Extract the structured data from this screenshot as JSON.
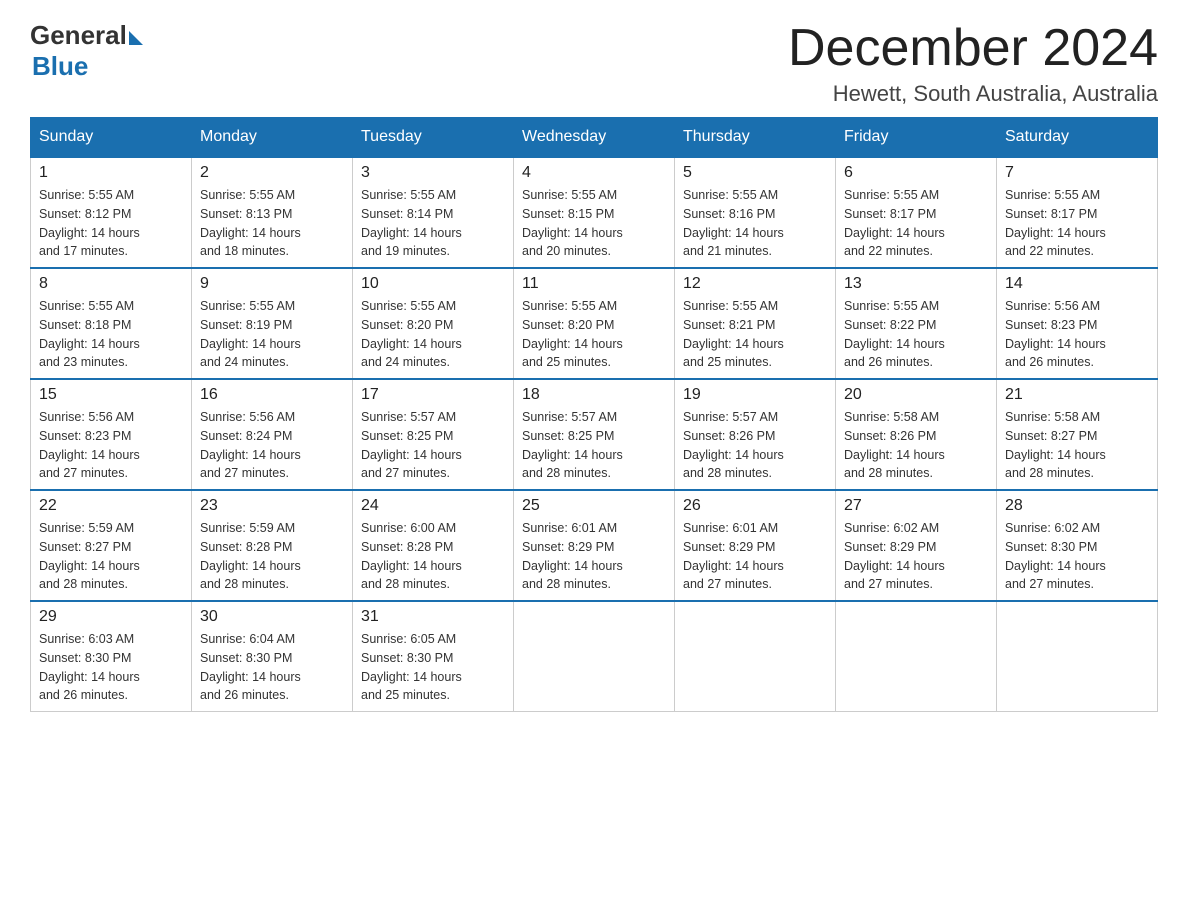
{
  "header": {
    "logo_general": "General",
    "logo_blue": "Blue",
    "month_title": "December 2024",
    "location": "Hewett, South Australia, Australia"
  },
  "days_of_week": [
    "Sunday",
    "Monday",
    "Tuesday",
    "Wednesday",
    "Thursday",
    "Friday",
    "Saturday"
  ],
  "weeks": [
    [
      {
        "day": "1",
        "sunrise": "5:55 AM",
        "sunset": "8:12 PM",
        "daylight": "14 hours and 17 minutes."
      },
      {
        "day": "2",
        "sunrise": "5:55 AM",
        "sunset": "8:13 PM",
        "daylight": "14 hours and 18 minutes."
      },
      {
        "day": "3",
        "sunrise": "5:55 AM",
        "sunset": "8:14 PM",
        "daylight": "14 hours and 19 minutes."
      },
      {
        "day": "4",
        "sunrise": "5:55 AM",
        "sunset": "8:15 PM",
        "daylight": "14 hours and 20 minutes."
      },
      {
        "day": "5",
        "sunrise": "5:55 AM",
        "sunset": "8:16 PM",
        "daylight": "14 hours and 21 minutes."
      },
      {
        "day": "6",
        "sunrise": "5:55 AM",
        "sunset": "8:17 PM",
        "daylight": "14 hours and 22 minutes."
      },
      {
        "day": "7",
        "sunrise": "5:55 AM",
        "sunset": "8:17 PM",
        "daylight": "14 hours and 22 minutes."
      }
    ],
    [
      {
        "day": "8",
        "sunrise": "5:55 AM",
        "sunset": "8:18 PM",
        "daylight": "14 hours and 23 minutes."
      },
      {
        "day": "9",
        "sunrise": "5:55 AM",
        "sunset": "8:19 PM",
        "daylight": "14 hours and 24 minutes."
      },
      {
        "day": "10",
        "sunrise": "5:55 AM",
        "sunset": "8:20 PM",
        "daylight": "14 hours and 24 minutes."
      },
      {
        "day": "11",
        "sunrise": "5:55 AM",
        "sunset": "8:20 PM",
        "daylight": "14 hours and 25 minutes."
      },
      {
        "day": "12",
        "sunrise": "5:55 AM",
        "sunset": "8:21 PM",
        "daylight": "14 hours and 25 minutes."
      },
      {
        "day": "13",
        "sunrise": "5:55 AM",
        "sunset": "8:22 PM",
        "daylight": "14 hours and 26 minutes."
      },
      {
        "day": "14",
        "sunrise": "5:56 AM",
        "sunset": "8:23 PM",
        "daylight": "14 hours and 26 minutes."
      }
    ],
    [
      {
        "day": "15",
        "sunrise": "5:56 AM",
        "sunset": "8:23 PM",
        "daylight": "14 hours and 27 minutes."
      },
      {
        "day": "16",
        "sunrise": "5:56 AM",
        "sunset": "8:24 PM",
        "daylight": "14 hours and 27 minutes."
      },
      {
        "day": "17",
        "sunrise": "5:57 AM",
        "sunset": "8:25 PM",
        "daylight": "14 hours and 27 minutes."
      },
      {
        "day": "18",
        "sunrise": "5:57 AM",
        "sunset": "8:25 PM",
        "daylight": "14 hours and 28 minutes."
      },
      {
        "day": "19",
        "sunrise": "5:57 AM",
        "sunset": "8:26 PM",
        "daylight": "14 hours and 28 minutes."
      },
      {
        "day": "20",
        "sunrise": "5:58 AM",
        "sunset": "8:26 PM",
        "daylight": "14 hours and 28 minutes."
      },
      {
        "day": "21",
        "sunrise": "5:58 AM",
        "sunset": "8:27 PM",
        "daylight": "14 hours and 28 minutes."
      }
    ],
    [
      {
        "day": "22",
        "sunrise": "5:59 AM",
        "sunset": "8:27 PM",
        "daylight": "14 hours and 28 minutes."
      },
      {
        "day": "23",
        "sunrise": "5:59 AM",
        "sunset": "8:28 PM",
        "daylight": "14 hours and 28 minutes."
      },
      {
        "day": "24",
        "sunrise": "6:00 AM",
        "sunset": "8:28 PM",
        "daylight": "14 hours and 28 minutes."
      },
      {
        "day": "25",
        "sunrise": "6:01 AM",
        "sunset": "8:29 PM",
        "daylight": "14 hours and 28 minutes."
      },
      {
        "day": "26",
        "sunrise": "6:01 AM",
        "sunset": "8:29 PM",
        "daylight": "14 hours and 27 minutes."
      },
      {
        "day": "27",
        "sunrise": "6:02 AM",
        "sunset": "8:29 PM",
        "daylight": "14 hours and 27 minutes."
      },
      {
        "day": "28",
        "sunrise": "6:02 AM",
        "sunset": "8:30 PM",
        "daylight": "14 hours and 27 minutes."
      }
    ],
    [
      {
        "day": "29",
        "sunrise": "6:03 AM",
        "sunset": "8:30 PM",
        "daylight": "14 hours and 26 minutes."
      },
      {
        "day": "30",
        "sunrise": "6:04 AM",
        "sunset": "8:30 PM",
        "daylight": "14 hours and 26 minutes."
      },
      {
        "day": "31",
        "sunrise": "6:05 AM",
        "sunset": "8:30 PM",
        "daylight": "14 hours and 25 minutes."
      },
      null,
      null,
      null,
      null
    ]
  ],
  "labels": {
    "sunrise": "Sunrise:",
    "sunset": "Sunset:",
    "daylight": "Daylight:"
  }
}
